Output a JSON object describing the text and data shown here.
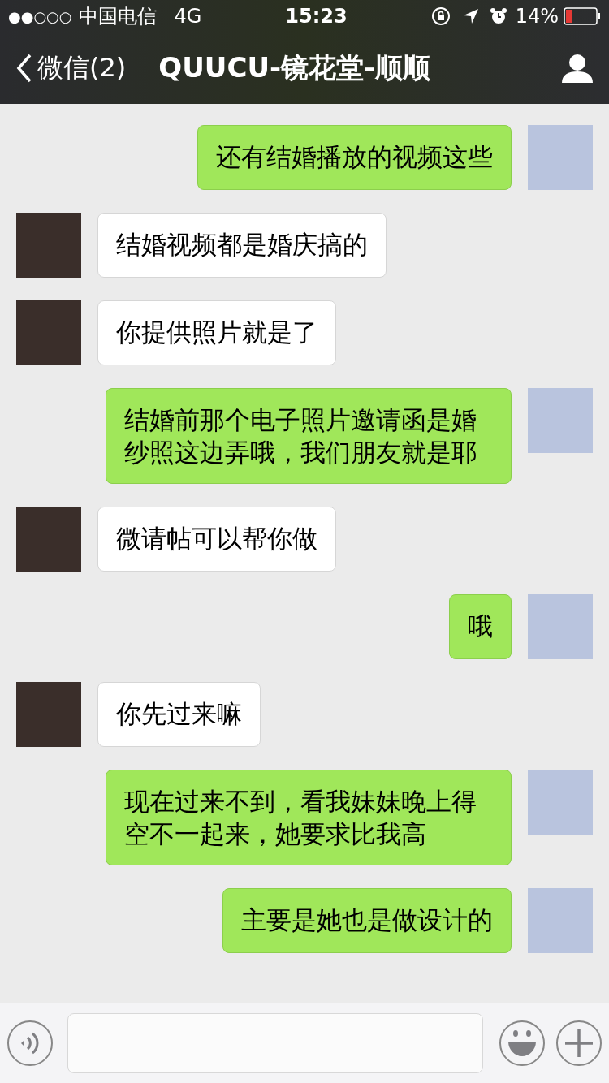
{
  "status_bar": {
    "signal": "●●○○○",
    "carrier": "中国电信",
    "network": "4G",
    "time": "15:23",
    "battery": "14%"
  },
  "nav": {
    "back": "微信(2)",
    "title": "QUUCU-镜花堂-顺顺"
  },
  "messages": [
    {
      "kind": "sent",
      "text": "还有结婚播放的视频这些"
    },
    {
      "kind": "received",
      "text": "结婚视频都是婚庆搞的"
    },
    {
      "kind": "received",
      "text": "你提供照片就是了"
    },
    {
      "kind": "sent",
      "text": "结婚前那个电子照片邀请函是婚纱照这边弄哦，我们朋友就是耶"
    },
    {
      "kind": "received",
      "text": "微请帖可以帮你做"
    },
    {
      "kind": "sent",
      "text": "哦"
    },
    {
      "kind": "received",
      "text": "你先过来嘛"
    },
    {
      "kind": "sent",
      "text": "现在过来不到，看我妹妹晚上得空不一起来，她要求比我高"
    },
    {
      "kind": "sent",
      "text": "主要是她也是做设计的"
    }
  ]
}
